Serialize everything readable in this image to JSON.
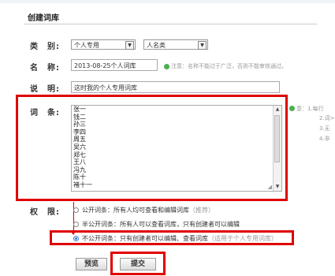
{
  "title": "创建词库",
  "labels": {
    "category": "类　别:",
    "name": "名　称:",
    "desc": "说　明:",
    "entries": "词　条:",
    "permission": "权　限:"
  },
  "category": {
    "select1": "个人专用",
    "select2": "人名类"
  },
  "name": {
    "value": "2013-08-25个人词库",
    "note": "注意：名称不能过于广泛，否则不能审核通过。"
  },
  "desc": {
    "value": "这时我的个人专用词库"
  },
  "entries": {
    "items": [
      "张一",
      "钱二",
      "孙三",
      "李四",
      "周五",
      "吴六",
      "郑七",
      "王八",
      "冯九",
      "陈十",
      "褚十一"
    ],
    "side_note_1": "意：1.每行",
    "side_note_2": "2.词>",
    "side_note_3": "3.无",
    "side_note_4": "4.非"
  },
  "permission": {
    "options": [
      {
        "label": "公开词条：所有人均可查看和编辑词库",
        "hint": "（推荐）",
        "selected": false
      },
      {
        "label": "半公开词条：所有人可以查看词库，只有创建者可以编辑",
        "hint": "",
        "selected": false
      },
      {
        "label": "不公开词条：只有创建者可以编辑、查看词库",
        "hint": "（适用于个人专用词库）",
        "selected": true
      }
    ]
  },
  "buttons": {
    "preview": "预览",
    "submit": "提交"
  },
  "colors": {
    "highlight": "#e00000",
    "note_icon": "#4caf50"
  }
}
